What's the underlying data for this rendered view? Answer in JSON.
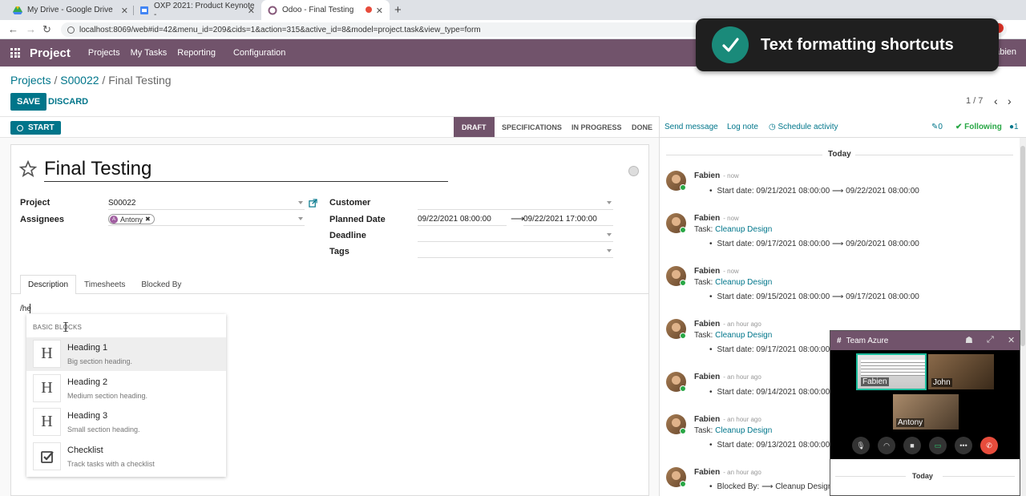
{
  "browser": {
    "tabs": [
      {
        "title": "My Drive - Google Drive",
        "icon": "google-drive-icon"
      },
      {
        "title": "OXP 2021: Product Keynote -",
        "icon": "google-slides-icon"
      },
      {
        "title": "Odoo - Final Testing",
        "icon": "odoo-icon"
      }
    ],
    "url": "localhost:8069/web#id=42&menu_id=209&cids=1&action=315&active_id=8&model=project.task&view_type=form"
  },
  "navbar": {
    "app_name": "Project",
    "menu": [
      "Projects",
      "My Tasks",
      "Reporting",
      "Configuration"
    ],
    "user": "abien",
    "color": "#71536b"
  },
  "breadcrumb": {
    "root": "Projects",
    "project": "S00022",
    "current": "Final Testing"
  },
  "control": {
    "save": "SAVE",
    "discard": "DISCARD",
    "pager": "1 / 7"
  },
  "statusbar": {
    "start": "START",
    "stages": [
      "DRAFT",
      "SPECIFICATIONS",
      "IN PROGRESS",
      "DONE"
    ],
    "active_stage": "DRAFT"
  },
  "form": {
    "title": "Final Testing",
    "labels": {
      "project": "Project",
      "assignees": "Assignees",
      "customer": "Customer",
      "planned_date": "Planned Date",
      "deadline": "Deadline",
      "tags": "Tags"
    },
    "values": {
      "project": "S00022",
      "assignee": "Antony",
      "assignee_initial": "A",
      "planned_start": "09/22/2021 08:00:00",
      "planned_end": "09/22/2021 17:00:00"
    },
    "tabs": [
      "Description",
      "Timesheets",
      "Blocked By"
    ],
    "editor_text": "/he"
  },
  "powerbox": {
    "category": "BASIC BLOCKS",
    "items": [
      {
        "title": "Heading 1",
        "desc": "Big section heading.",
        "glyph": "H"
      },
      {
        "title": "Heading 2",
        "desc": "Medium section heading.",
        "glyph": "H"
      },
      {
        "title": "Heading 3",
        "desc": "Small section heading.",
        "glyph": "H"
      },
      {
        "title": "Checklist",
        "desc": "Track tasks with a checklist",
        "glyph": "checklist-icon"
      }
    ]
  },
  "toast": {
    "text": "Text formatting shortcuts"
  },
  "chatter": {
    "send_message": "Send message",
    "log_note": "Log note",
    "schedule_activity": "Schedule activity",
    "attachments": "0",
    "following": "Following",
    "followers": "1",
    "today": "Today",
    "messages": [
      {
        "author": "Fabien",
        "time": "- now",
        "task": "",
        "change": "Start date: 09/21/2021 08:00:00 ⟶ 09/22/2021 08:00:00"
      },
      {
        "author": "Fabien",
        "time": "- now",
        "task": "Cleanup Design",
        "change": "Start date: 09/17/2021 08:00:00 ⟶ 09/20/2021 08:00:00"
      },
      {
        "author": "Fabien",
        "time": "- now",
        "task": "Cleanup Design",
        "change": "Start date: 09/15/2021 08:00:00 ⟶ 09/17/2021 08:00:00"
      },
      {
        "author": "Fabien",
        "time": "- an hour ago",
        "task": "Cleanup Design",
        "change": "Start date: 09/17/2021 08:00:00"
      },
      {
        "author": "Fabien",
        "time": "- an hour ago",
        "task": "",
        "change": "Start date: 09/14/2021 08:00:00"
      },
      {
        "author": "Fabien",
        "time": "- an hour ago",
        "task": "Cleanup Design",
        "change": "Start date: 09/13/2021 08:00:00"
      },
      {
        "author": "Fabien",
        "time": "- an hour ago",
        "task": "",
        "change": "Blocked By: ⟶ Cleanup Design"
      }
    ],
    "task_prefix": "Task:"
  },
  "call": {
    "channel": "Team Azure",
    "participants": [
      "Fabien",
      "John",
      "Antony"
    ],
    "footer_today": "Today"
  }
}
